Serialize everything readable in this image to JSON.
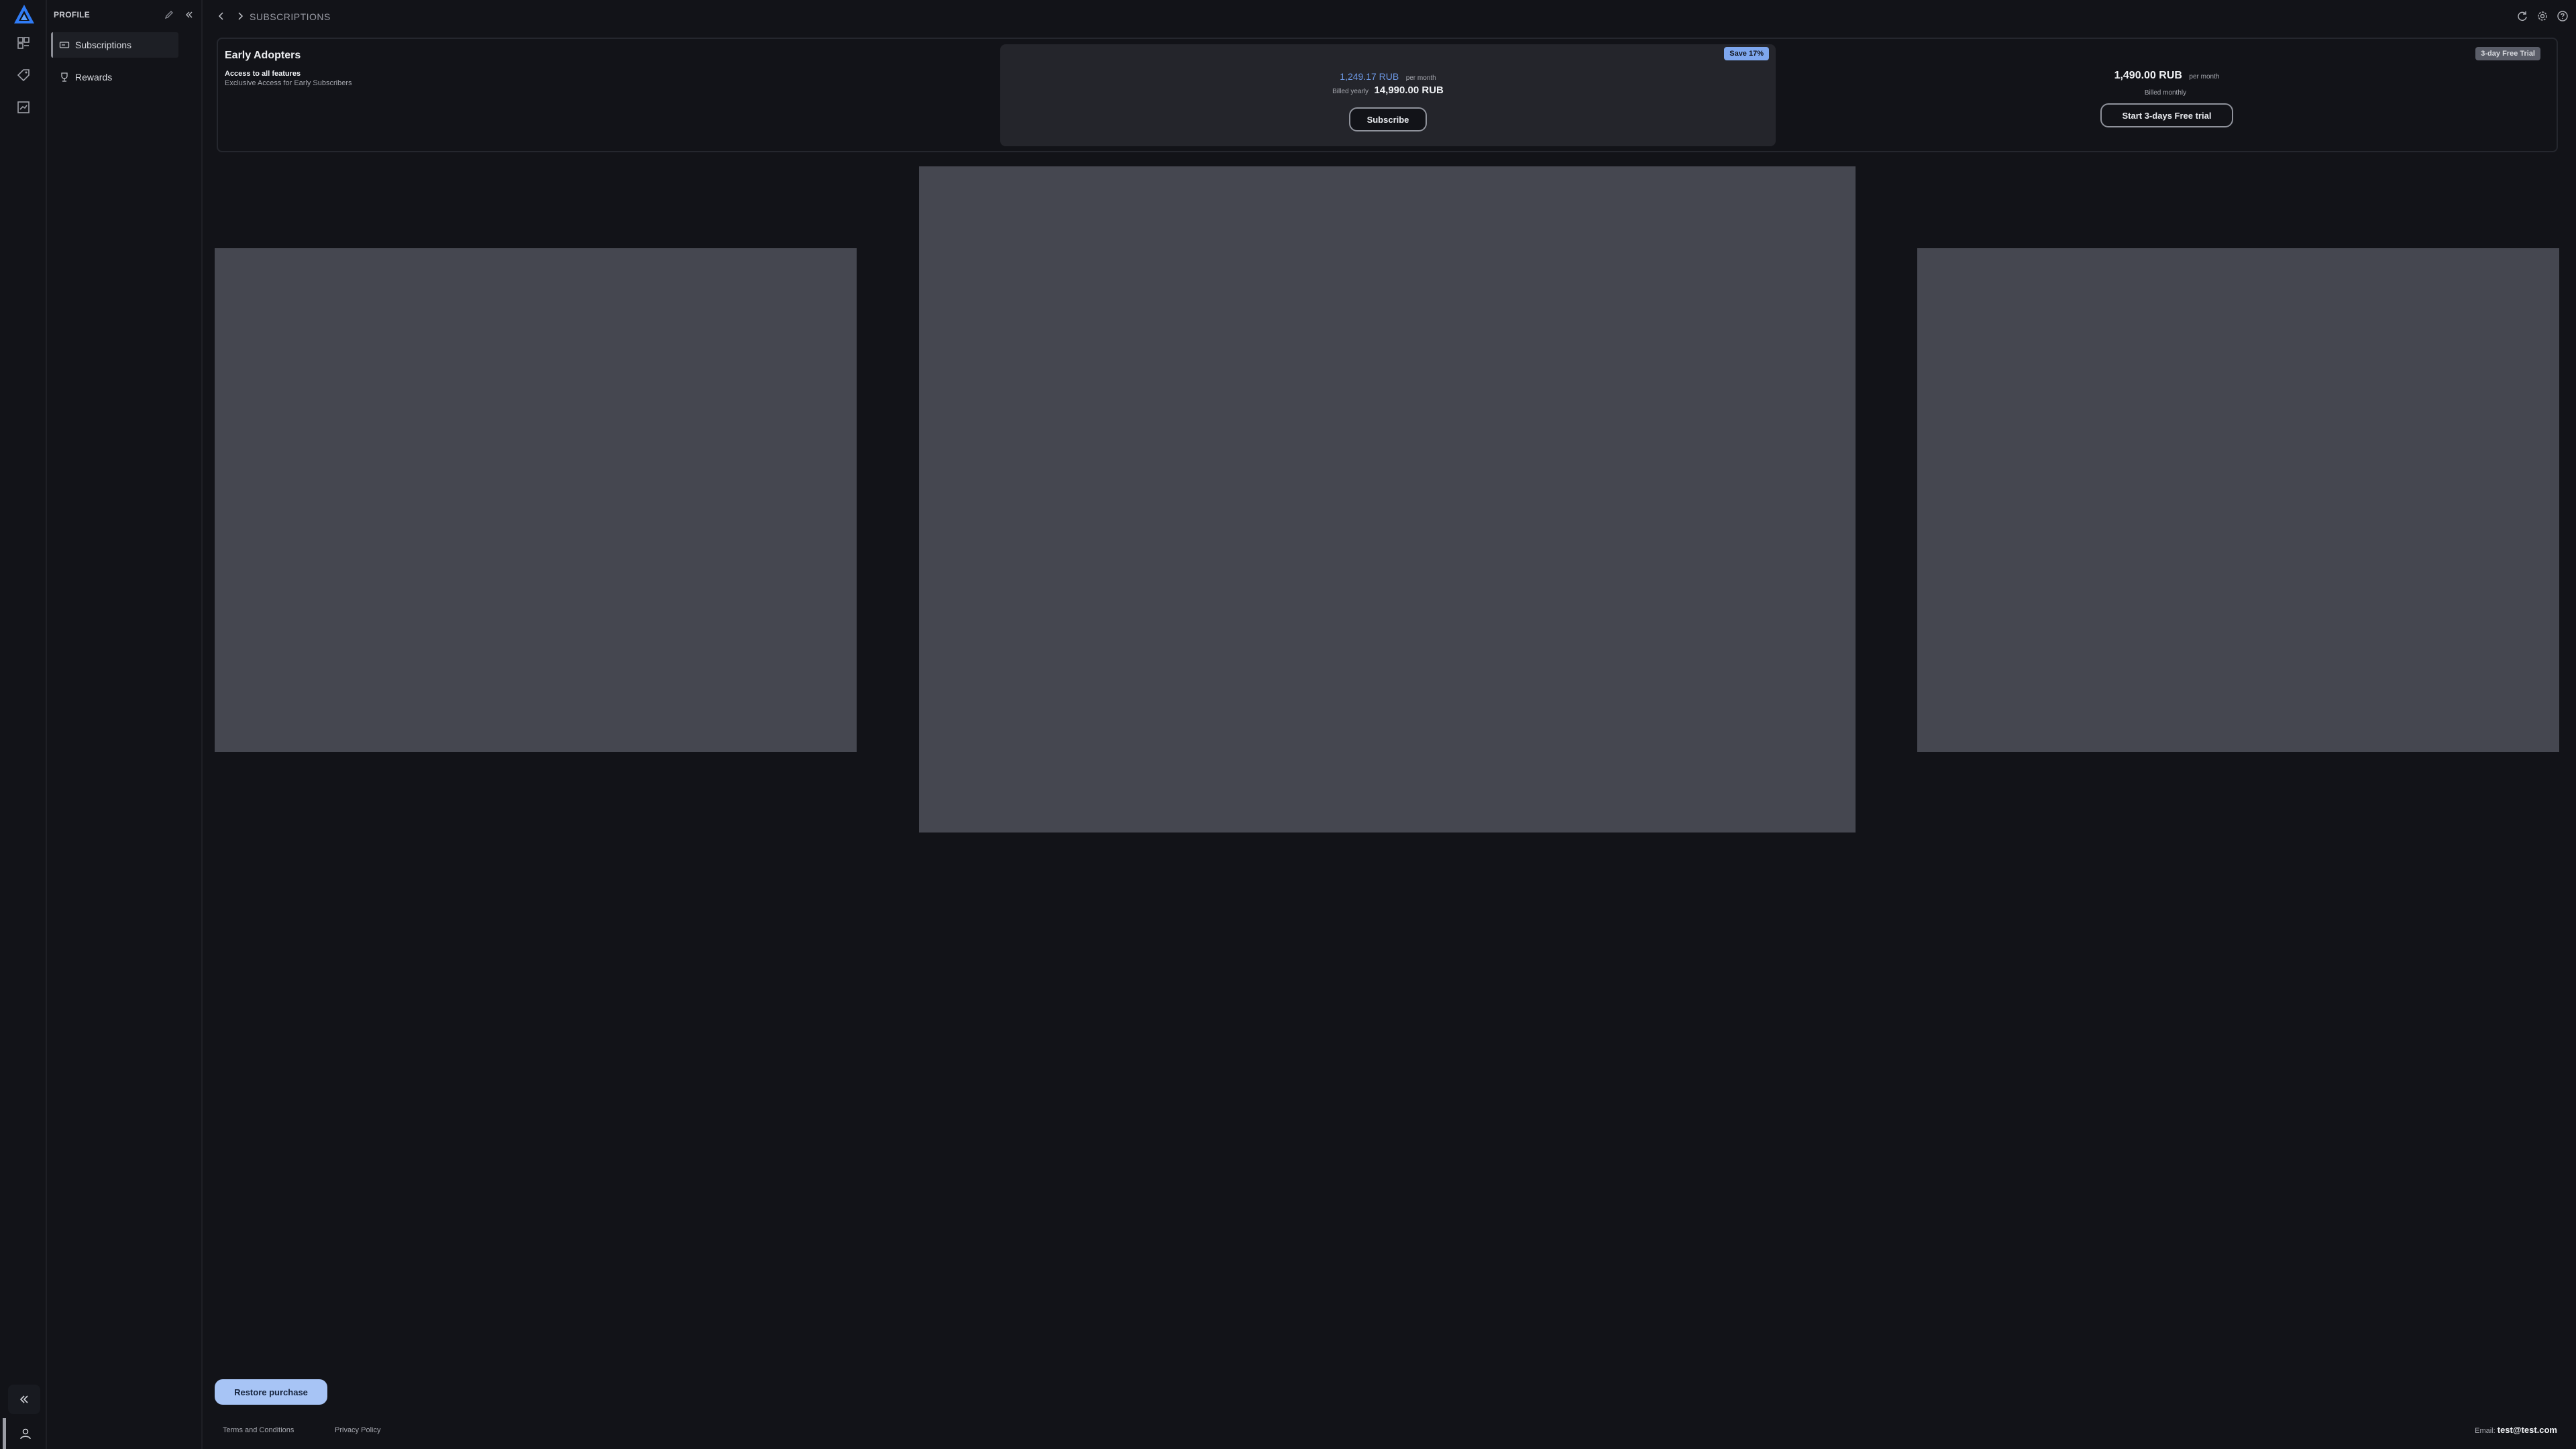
{
  "rail": {
    "icons": [
      "logo-icon",
      "dashboard-icon",
      "tag-icon",
      "chart-icon"
    ],
    "collapse_icon": "double-chevron-left-icon",
    "user_icon": "user-icon"
  },
  "sidebar": {
    "title": "PROFILE",
    "items": [
      {
        "label": "Subscriptions",
        "icon": "subscription-icon",
        "active": true
      },
      {
        "label": "Rewards",
        "icon": "trophy-icon",
        "active": false
      }
    ]
  },
  "topbar": {
    "breadcrumb": "SUBSCRIPTIONS",
    "icons": [
      "refresh-icon",
      "settings-icon",
      "help-icon"
    ]
  },
  "plan": {
    "name": "Early Adopters",
    "feature": "Access to all features",
    "description": "Exclusive Access for Early Subscribers",
    "yearly": {
      "badge": "Save 17%",
      "monthly_price": "1,249.17 RUB",
      "per_month": "per month",
      "billed_label": "Billed yearly",
      "billed_price": "14,990.00 RUB",
      "button": "Subscribe"
    },
    "monthly": {
      "badge": "3-day Free Trial",
      "price": "1,490.00 RUB",
      "per_month": "per month",
      "billed_label": "Billed monthly",
      "button": "Start 3-days Free trial"
    }
  },
  "footer": {
    "restore_button": "Restore purchase",
    "terms": "Terms and Conditions",
    "privacy": "Privacy Policy",
    "email_label": "Email:",
    "email_value": "test@test.com"
  },
  "colors": {
    "background": "#121318",
    "accent": "#7ea7ee",
    "slide": "#454750"
  }
}
